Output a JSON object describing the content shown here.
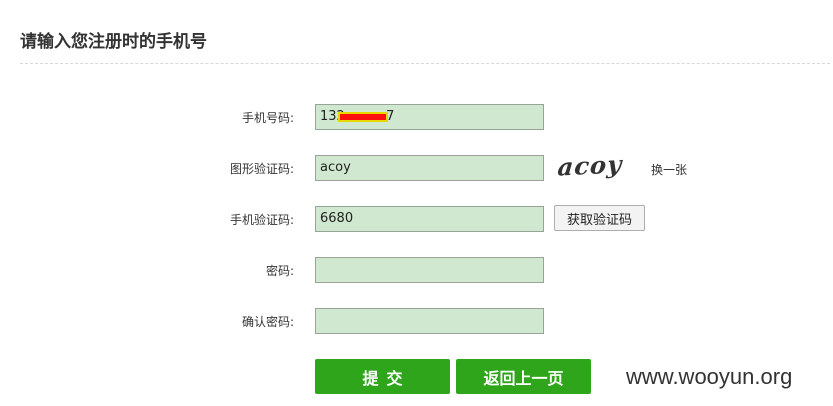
{
  "page": {
    "title": "请输入您注册时的手机号"
  },
  "form": {
    "phone": {
      "label": "手机号码:",
      "value": "132          7"
    },
    "captcha": {
      "label": "图形验证码:",
      "value": "acoy",
      "image_text": "acoy",
      "refresh_label": "换一张"
    },
    "sms_code": {
      "label": "手机验证码:",
      "value": "6680",
      "get_code_label": "获取验证码"
    },
    "password": {
      "label": "密码:",
      "value": ""
    },
    "confirm_password": {
      "label": "确认密码:",
      "value": ""
    }
  },
  "actions": {
    "submit_label": "提交",
    "back_label": "返回上一页"
  },
  "watermark": "www.wooyun.org",
  "colors": {
    "input_bg": "#cfe8cf",
    "button_green": "#2ea51b",
    "redaction": "#ff1010"
  }
}
